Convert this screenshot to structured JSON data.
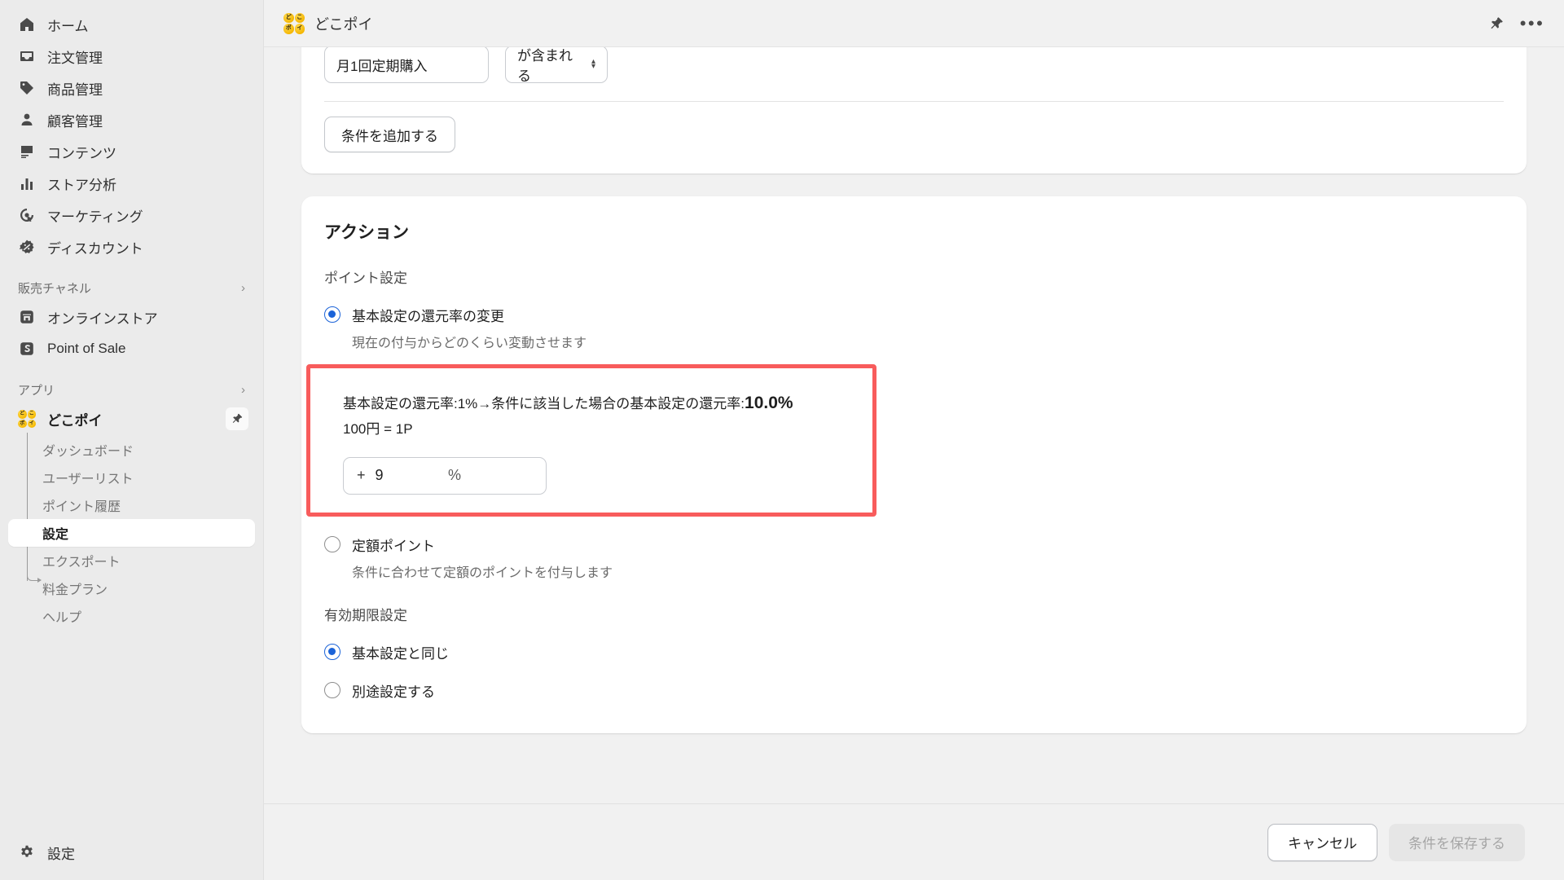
{
  "sidebar": {
    "primary_items": [
      {
        "label": "ホーム",
        "icon": "home-icon"
      },
      {
        "label": "注文管理",
        "icon": "orders-inbox-icon"
      },
      {
        "label": "商品管理",
        "icon": "product-tag-icon"
      },
      {
        "label": "顧客管理",
        "icon": "customer-person-icon"
      },
      {
        "label": "コンテンツ",
        "icon": "content-image-icon"
      },
      {
        "label": "ストア分析",
        "icon": "analytics-bars-icon"
      },
      {
        "label": "マーケティング",
        "icon": "marketing-target-icon"
      },
      {
        "label": "ディスカウント",
        "icon": "discount-badge-icon"
      }
    ],
    "sales_channel_section": {
      "label": "販売チャネル",
      "chevron": "›"
    },
    "sales_channel_items": [
      {
        "label": "オンラインストア",
        "icon": "online-store-icon"
      },
      {
        "label": "Point of Sale",
        "icon": "point-of-sale-icon"
      }
    ],
    "apps_section": {
      "label": "アプリ",
      "chevron": "›"
    },
    "app": {
      "name": "どこポイ",
      "icon_chars": [
        "ど",
        "こ",
        "ポ",
        "イ"
      ],
      "pin_icon": "pin-icon"
    },
    "app_sub_items": [
      {
        "label": "ダッシュボード",
        "active": false
      },
      {
        "label": "ユーザーリスト",
        "active": false
      },
      {
        "label": "ポイント履歴",
        "active": false
      },
      {
        "label": "設定",
        "active": true
      },
      {
        "label": "エクスポート",
        "active": false
      },
      {
        "label": "料金プラン",
        "active": false
      },
      {
        "label": "ヘルプ",
        "active": false
      }
    ],
    "bottom_item": {
      "label": "設定",
      "icon": "gear-icon"
    }
  },
  "topbar": {
    "title": "どこポイ",
    "icon_chars": [
      "ど",
      "こ",
      "ポ",
      "イ"
    ],
    "pin_icon": "pin-icon",
    "more_icon": "more-dots-icon",
    "more_glyph": "•••"
  },
  "conditions_card": {
    "condition_value": "月1回定期購入",
    "condition_operator": "が含まれる",
    "add_condition_label": "条件を追加する"
  },
  "action_card": {
    "title": "アクション",
    "point_setting_label": "ポイント設定",
    "options": [
      {
        "label": "基本設定の還元率の変更",
        "description": "現在の付与からどのくらい変動させます",
        "checked": true
      },
      {
        "label": "定額ポイント",
        "description": "条件に合わせて定額のポイントを付与します",
        "checked": false
      }
    ],
    "highlight": {
      "rate_text_prefix": "基本設定の還元率:1%→条件に該当した場合の基本設定の還元率:",
      "rate_value": "10.0%",
      "rate_conversion": "100円 = 1P",
      "input_prefix": "+",
      "input_value": "9",
      "input_suffix": "%",
      "border_color": "#f85c5c"
    },
    "expiry_label": "有効期限設定",
    "expiry_options": [
      {
        "label": "基本設定と同じ",
        "checked": true
      },
      {
        "label": "別途設定する",
        "checked": false
      }
    ]
  },
  "footer": {
    "cancel_label": "キャンセル",
    "save_label": "条件を保存する"
  },
  "colors": {
    "accent_blue": "#1b63d8",
    "highlight_red": "#f85c5c",
    "sidebar_bg": "#ebebeb",
    "page_bg": "#f1f1f1"
  }
}
